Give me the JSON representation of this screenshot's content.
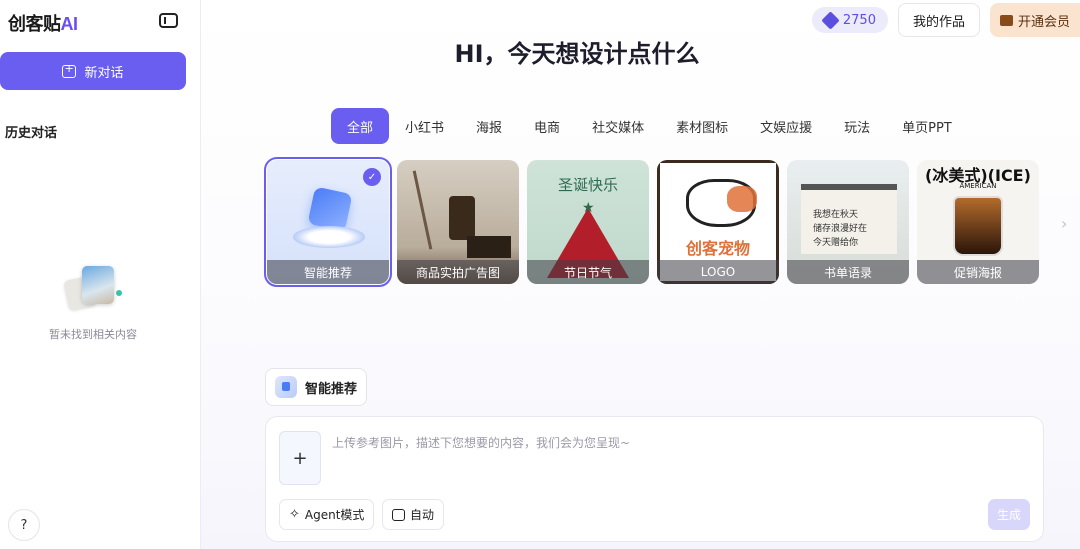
{
  "sidebar": {
    "brand_text": "创客贴",
    "brand_ai": "AI",
    "new_chat_label": "新对话",
    "history_title": "历史对话",
    "empty_text": "暂未找到相关内容",
    "help_label": "?"
  },
  "header": {
    "credits": "2750",
    "my_works_label": "我的作品",
    "vip_label": "开通会员"
  },
  "main": {
    "headline": "HI，今天想设计点什么",
    "tabs": [
      {
        "label": "全部",
        "active": true
      },
      {
        "label": "小红书"
      },
      {
        "label": "海报"
      },
      {
        "label": "电商"
      },
      {
        "label": "社交媒体"
      },
      {
        "label": "素材图标"
      },
      {
        "label": "文娱应援"
      },
      {
        "label": "玩法"
      },
      {
        "label": "单页PPT"
      }
    ],
    "cards": [
      {
        "label": "智能推荐",
        "selected": true
      },
      {
        "label": "商品实拍广告图"
      },
      {
        "label": "节日节气",
        "art_text": "圣诞快乐"
      },
      {
        "label": "LOGO",
        "art_text": "创客宠物"
      },
      {
        "label": "书单语录",
        "art_lines": [
          "我想在秋天",
          "储存浪漫好在",
          "今天赠给你"
        ]
      },
      {
        "label": "促销海报",
        "art_text": "(冰美式)(ICE)",
        "art_sub": "AMERICAN"
      }
    ],
    "mode_chip_label": "智能推荐",
    "composer": {
      "upload_label": "+",
      "placeholder": "上传参考图片，描述下您想要的内容，我们会为您呈现~",
      "agent_label": "Agent模式",
      "auto_label": "自动",
      "generate_label": "生成"
    }
  },
  "colors": {
    "accent": "#6a5ef0",
    "vip_bg": "#fbe4cf",
    "generate_disabled": "#d8d6fb"
  }
}
